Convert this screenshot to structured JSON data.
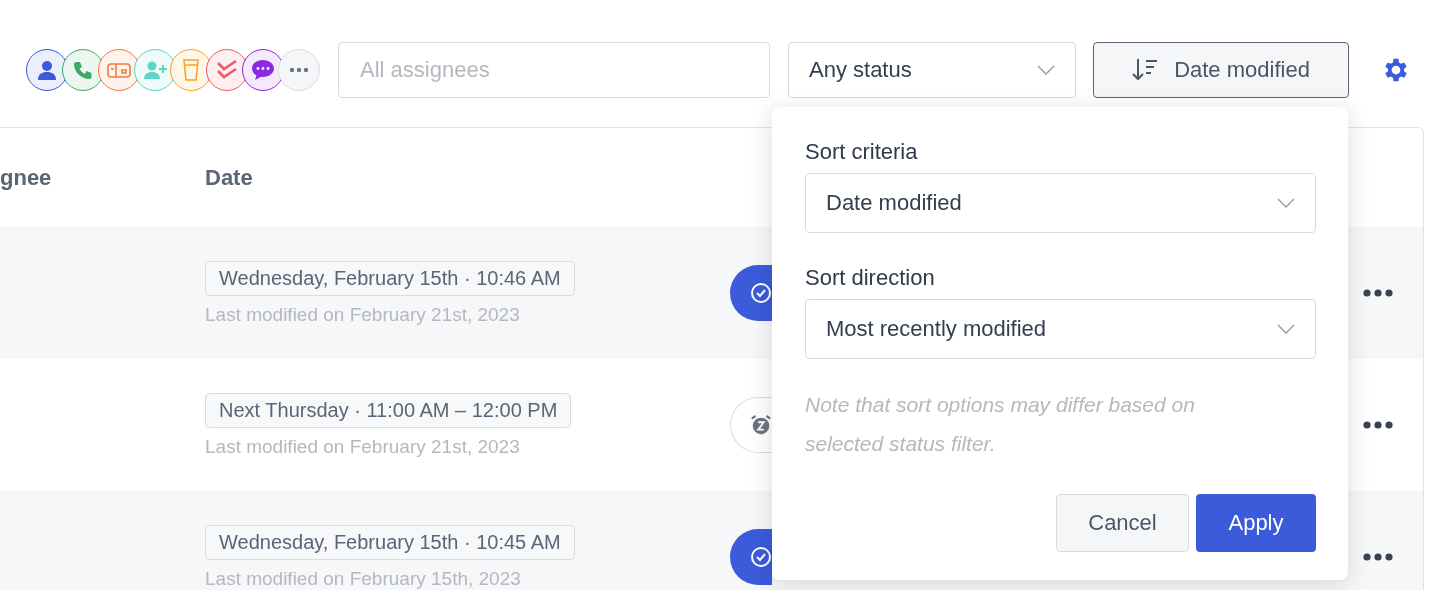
{
  "toolbar": {
    "assignee_filters": [
      {
        "kind": "person",
        "color": "#3b5bdb"
      },
      {
        "kind": "phone",
        "color": "#40a86b"
      },
      {
        "kind": "mailbox",
        "color": "#f07b3f"
      },
      {
        "kind": "add-person",
        "color": "#5fd3c6"
      },
      {
        "kind": "cup",
        "color": "#f5a524"
      },
      {
        "kind": "double-check",
        "color": "#e85b6a"
      },
      {
        "kind": "chat",
        "color": "#8a2be2"
      },
      {
        "kind": "more"
      }
    ],
    "assignee_field": {
      "placeholder": "All assignees"
    },
    "status_select": {
      "value": "Any status"
    },
    "sort_button": {
      "label": "Date modified"
    }
  },
  "table": {
    "columns": [
      "gnee",
      "Date"
    ],
    "rows": [
      {
        "date": "Wednesday, February 15th · 10:46 AM",
        "modified": "Last modified on February 21st, 2023",
        "status_pill": {
          "kind": "done"
        }
      },
      {
        "date": "Next Thursday · 11:00 AM – 12:00 PM",
        "modified": "Last modified on February 21st, 2023",
        "status_pill": {
          "kind": "snoozed"
        }
      },
      {
        "date": "Wednesday, February 15th · 10:45 AM",
        "modified": "Last modified on February 15th, 2023",
        "status_pill": {
          "kind": "done"
        }
      }
    ]
  },
  "sort_popover": {
    "criteria_label": "Sort criteria",
    "criteria_value": "Date modified",
    "direction_label": "Sort direction",
    "direction_value": "Most recently modified",
    "note": "Note that sort options may differ based on selected status filter.",
    "buttons": [
      "Cancel",
      "Apply"
    ]
  }
}
